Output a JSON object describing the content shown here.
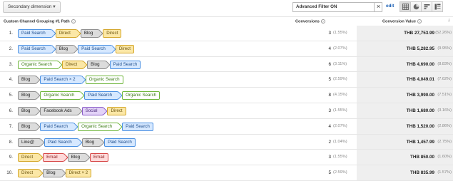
{
  "toolbar": {
    "secondary_dimension_label": "Secondary dimension",
    "filter_value": "Advanced Filter ON",
    "clear_symbol": "×",
    "edit_label": "edit",
    "view_buttons": [
      "table-view-icon",
      "pie-view-icon",
      "bar-view-icon",
      "pivot-view-icon"
    ]
  },
  "table": {
    "headers": {
      "path": "Custom Channel Grouping #1 Path",
      "conversions": "Conversions",
      "value": "Conversion Value",
      "help": "?",
      "sort_arrow": "↓"
    },
    "channel_colors": {
      "Paid Search": {
        "bg": "#d6e8ff",
        "border": "#4a90e2",
        "text": "#1f4e8c"
      },
      "Direct": {
        "bg": "#fbe7a6",
        "border": "#d4a72c",
        "text": "#6b5410"
      },
      "Blog": {
        "bg": "#dcdcdc",
        "border": "#8e8e8e",
        "text": "#222222"
      },
      "Organic Search": {
        "bg": "#ffffff",
        "border": "#6fb63c",
        "text": "#3d7d16"
      },
      "Facebook Ads": {
        "bg": "#dcdcdc",
        "border": "#8e8e8e",
        "text": "#222222"
      },
      "Social": {
        "bg": "#e2d2f7",
        "border": "#8a5cc7",
        "text": "#4a2a7a"
      },
      "Line@": {
        "bg": "#dcdcdc",
        "border": "#8e8e8e",
        "text": "#222222"
      },
      "Email": {
        "bg": "#fdd9d9",
        "border": "#d64545",
        "text": "#8f1f1f"
      }
    },
    "rows": [
      {
        "num": "1.",
        "path": [
          {
            "label": "Paid Search",
            "type": "Paid Search"
          },
          {
            "label": "Direct",
            "type": "Direct"
          },
          {
            "label": "Blog",
            "type": "Blog"
          },
          {
            "label": "Direct",
            "type": "Direct"
          }
        ],
        "conversions": "3",
        "conv_pct": "(1.55%)",
        "value": "THB 27,753.99",
        "value_pct": "(52.26%)"
      },
      {
        "num": "2.",
        "path": [
          {
            "label": "Paid Search",
            "type": "Paid Search"
          },
          {
            "label": "Blog",
            "type": "Blog"
          },
          {
            "label": "Paid Search",
            "type": "Paid Search"
          },
          {
            "label": "Direct",
            "type": "Direct"
          }
        ],
        "conversions": "4",
        "conv_pct": "(2.07%)",
        "value": "THB 5,282.95",
        "value_pct": "(9.95%)"
      },
      {
        "num": "3.",
        "path": [
          {
            "label": "Organic Search",
            "type": "Organic Search"
          },
          {
            "label": "Direct",
            "type": "Direct"
          },
          {
            "label": "Blog",
            "type": "Blog"
          },
          {
            "label": "Paid Search",
            "type": "Paid Search"
          }
        ],
        "conversions": "6",
        "conv_pct": "(3.11%)",
        "value": "THB 4,690.00",
        "value_pct": "(8.83%)"
      },
      {
        "num": "4.",
        "path": [
          {
            "label": "Blog",
            "type": "Blog"
          },
          {
            "label": "Paid Search × 2",
            "type": "Paid Search"
          },
          {
            "label": "Organic Search",
            "type": "Organic Search"
          }
        ],
        "conversions": "5",
        "conv_pct": "(2.59%)",
        "value": "THB 4,049.01",
        "value_pct": "(7.62%)"
      },
      {
        "num": "5.",
        "path": [
          {
            "label": "Blog",
            "type": "Blog"
          },
          {
            "label": "Organic Search",
            "type": "Organic Search"
          },
          {
            "label": "Paid Search",
            "type": "Paid Search"
          },
          {
            "label": "Organic Search",
            "type": "Organic Search"
          }
        ],
        "conversions": "8",
        "conv_pct": "(4.15%)",
        "value": "THB 3,990.00",
        "value_pct": "(7.51%)"
      },
      {
        "num": "6.",
        "path": [
          {
            "label": "Blog",
            "type": "Blog"
          },
          {
            "label": "Facebook Ads",
            "type": "Facebook Ads"
          },
          {
            "label": "Social",
            "type": "Social"
          },
          {
            "label": "Direct",
            "type": "Direct"
          }
        ],
        "conversions": "3",
        "conv_pct": "(1.55%)",
        "value": "THB 1,680.00",
        "value_pct": "(3.16%)"
      },
      {
        "num": "7.",
        "path": [
          {
            "label": "Blog",
            "type": "Blog"
          },
          {
            "label": "Paid Search",
            "type": "Paid Search"
          },
          {
            "label": "Organic Search",
            "type": "Organic Search"
          },
          {
            "label": "Paid Search",
            "type": "Paid Search"
          }
        ],
        "conversions": "4",
        "conv_pct": "(2.07%)",
        "value": "THB 1,520.00",
        "value_pct": "(2.86%)"
      },
      {
        "num": "8.",
        "path": [
          {
            "label": "Line@",
            "type": "Line@"
          },
          {
            "label": "Paid Search",
            "type": "Paid Search"
          },
          {
            "label": "Blog",
            "type": "Blog"
          },
          {
            "label": "Paid Search",
            "type": "Paid Search"
          }
        ],
        "conversions": "2",
        "conv_pct": "(1.04%)",
        "value": "THB 1,457.99",
        "value_pct": "(2.75%)"
      },
      {
        "num": "9.",
        "path": [
          {
            "label": "Direct",
            "type": "Direct"
          },
          {
            "label": "Email",
            "type": "Email"
          },
          {
            "label": "Blog",
            "type": "Blog"
          },
          {
            "label": "Email",
            "type": "Email"
          }
        ],
        "conversions": "3",
        "conv_pct": "(1.55%)",
        "value": "THB 850.00",
        "value_pct": "(1.60%)"
      },
      {
        "num": "10.",
        "path": [
          {
            "label": "Direct",
            "type": "Direct"
          },
          {
            "label": "Blog",
            "type": "Blog"
          },
          {
            "label": "Direct × 2",
            "type": "Direct"
          }
        ],
        "conversions": "5",
        "conv_pct": "(2.59%)",
        "value": "THB 835.99",
        "value_pct": "(1.57%)"
      }
    ]
  }
}
